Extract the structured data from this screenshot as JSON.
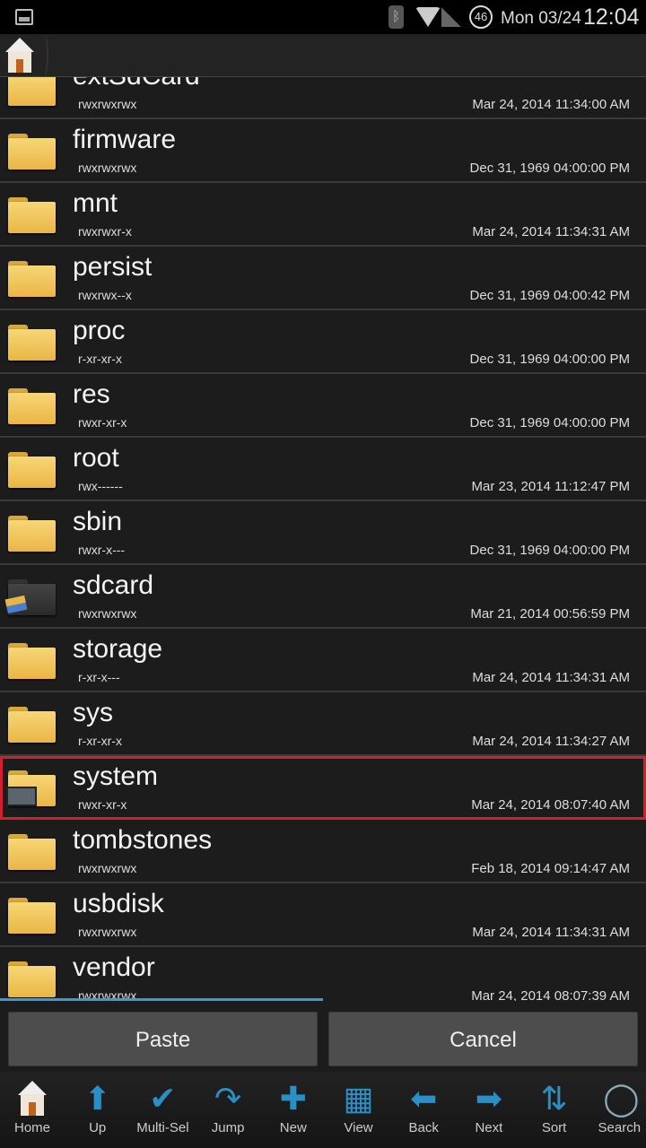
{
  "status_bar": {
    "date": "Mon 03/24",
    "time": "12:04",
    "battery": "46",
    "icons": [
      "image-icon",
      "bluetooth-icon",
      "wifi-icon",
      "signal-icon",
      "battery-icon"
    ]
  },
  "header": {
    "breadcrumb": [
      {
        "icon": "home-icon"
      }
    ]
  },
  "files": [
    {
      "name": "extSdCard",
      "perm": "rwxrwxrwx",
      "modified": "Mar 24, 2014 11:34:00 AM",
      "icon": "folder"
    },
    {
      "name": "firmware",
      "perm": "rwxrwxrwx",
      "modified": "Dec 31, 1969 04:00:00 PM",
      "icon": "folder"
    },
    {
      "name": "mnt",
      "perm": "rwxrwxr-x",
      "modified": "Mar 24, 2014 11:34:31 AM",
      "icon": "folder"
    },
    {
      "name": "persist",
      "perm": "rwxrwx--x",
      "modified": "Dec 31, 1969 04:00:42 PM",
      "icon": "folder"
    },
    {
      "name": "proc",
      "perm": "r-xr-xr-x",
      "modified": "Dec 31, 1969 04:00:00 PM",
      "icon": "folder"
    },
    {
      "name": "res",
      "perm": "rwxr-xr-x",
      "modified": "Dec 31, 1969 04:00:00 PM",
      "icon": "folder"
    },
    {
      "name": "root",
      "perm": "rwx------",
      "modified": "Mar 23, 2014 11:12:47 PM",
      "icon": "folder"
    },
    {
      "name": "sbin",
      "perm": "rwxr-x---",
      "modified": "Dec 31, 1969 04:00:00 PM",
      "icon": "folder"
    },
    {
      "name": "sdcard",
      "perm": "rwxrwxrwx",
      "modified": "Mar 21, 2014 00:56:59 PM",
      "icon": "sdcard-folder"
    },
    {
      "name": "storage",
      "perm": "r-xr-x---",
      "modified": "Mar 24, 2014 11:34:31 AM",
      "icon": "folder"
    },
    {
      "name": "sys",
      "perm": "r-xr-xr-x",
      "modified": "Mar 24, 2014 11:34:27 AM",
      "icon": "folder"
    },
    {
      "name": "system",
      "perm": "rwxr-xr-x",
      "modified": "Mar 24, 2014 08:07:40 AM",
      "icon": "system-folder",
      "selected": true
    },
    {
      "name": "tombstones",
      "perm": "rwxrwxrwx",
      "modified": "Feb 18, 2014 09:14:47 AM",
      "icon": "folder"
    },
    {
      "name": "usbdisk",
      "perm": "rwxrwxrwx",
      "modified": "Mar 24, 2014 11:34:31 AM",
      "icon": "folder"
    },
    {
      "name": "vendor",
      "perm": "rwxrwxrwx",
      "modified": "Mar 24, 2014 08:07:39 AM",
      "icon": "folder"
    }
  ],
  "actions": {
    "paste": "Paste",
    "cancel": "Cancel"
  },
  "toolbar": [
    {
      "label": "Home",
      "icon": "home-icon"
    },
    {
      "label": "Up",
      "icon": "up-arrow-icon"
    },
    {
      "label": "Multi-Sel",
      "icon": "checkmark-icon"
    },
    {
      "label": "Jump",
      "icon": "jump-arrow-icon"
    },
    {
      "label": "New",
      "icon": "plus-icon"
    },
    {
      "label": "View",
      "icon": "grid-icon"
    },
    {
      "label": "Back",
      "icon": "left-arrow-icon"
    },
    {
      "label": "Next",
      "icon": "right-arrow-icon"
    },
    {
      "label": "Sort",
      "icon": "sort-icon"
    },
    {
      "label": "Search",
      "icon": "search-icon"
    }
  ],
  "colors": {
    "accent": "#2a8fc4",
    "selection": "#d0202a",
    "folder": "#e9b645"
  }
}
